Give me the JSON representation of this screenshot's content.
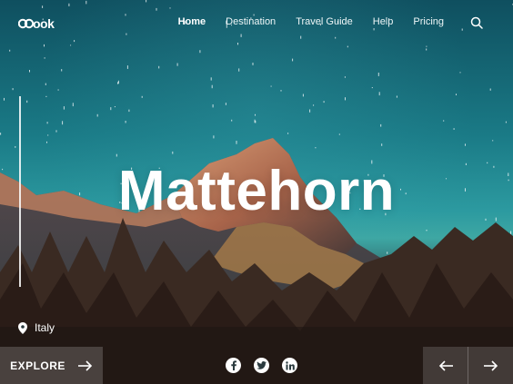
{
  "logo": {
    "text": "ook"
  },
  "nav": {
    "items": [
      {
        "label": "Home",
        "active": true
      },
      {
        "label": "Destination",
        "active": false
      },
      {
        "label": "Travel Guide",
        "active": false
      },
      {
        "label": "Help",
        "active": false
      },
      {
        "label": "Pricing",
        "active": false
      }
    ],
    "search_icon": "search-icon"
  },
  "hero": {
    "title": "Mattehorn",
    "location": "Italy"
  },
  "cta": {
    "label": "EXPLORE"
  },
  "social": [
    "facebook-icon",
    "twitter-icon",
    "linkedin-icon"
  ],
  "colors": {
    "sky_top": "#0f4f5f",
    "sky_mid": "#2c9aa0",
    "text": "#ffffff"
  }
}
